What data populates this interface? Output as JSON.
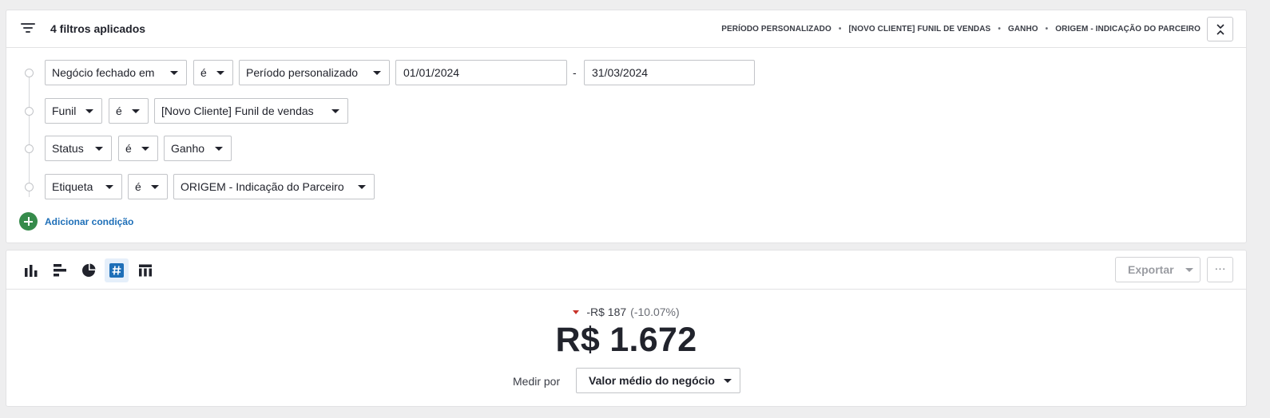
{
  "filters": {
    "count_label": "4 filtros aplicados",
    "chips": [
      "PERÍODO PERSONALIZADO",
      "[NOVO CLIENTE] FUNIL DE VENDAS",
      "GANHO",
      "ORIGEM - INDICAÇÃO DO PARCEIRO"
    ],
    "chip_separator": "•",
    "rows": [
      {
        "field": "Negócio fechado em",
        "operator": "é",
        "value": "Período personalizado",
        "date_from": "01/01/2024",
        "date_to": "31/03/2024",
        "range_separator": "-"
      },
      {
        "field": "Funil",
        "operator": "é",
        "value": "[Novo Cliente] Funil de vendas"
      },
      {
        "field": "Status",
        "operator": "é",
        "value": "Ganho"
      },
      {
        "field": "Etiqueta",
        "operator": "é",
        "value": "ORIGEM - Indicação do Parceiro"
      }
    ],
    "add_condition_label": "Adicionar condição"
  },
  "report": {
    "visualizations": [
      {
        "name": "vertical-bar-chart-icon",
        "active": false
      },
      {
        "name": "horizontal-bar-chart-icon",
        "active": false
      },
      {
        "name": "pie-chart-icon",
        "active": false
      },
      {
        "name": "scorecard-number-icon",
        "active": true
      },
      {
        "name": "table-icon",
        "active": false
      }
    ],
    "export_label": "Exportar",
    "more_label": "···",
    "delta_value": "-R$ 187",
    "delta_percent": "(-10.07%)",
    "main_value": "R$ 1.672",
    "measure_label": "Medir por",
    "measure_value": "Valor médio do negócio"
  },
  "colors": {
    "accent_blue": "#1e6fb8",
    "add_green": "#368b4b",
    "negative_red": "#c8332a",
    "active_viz_bg": "#e5effa"
  }
}
